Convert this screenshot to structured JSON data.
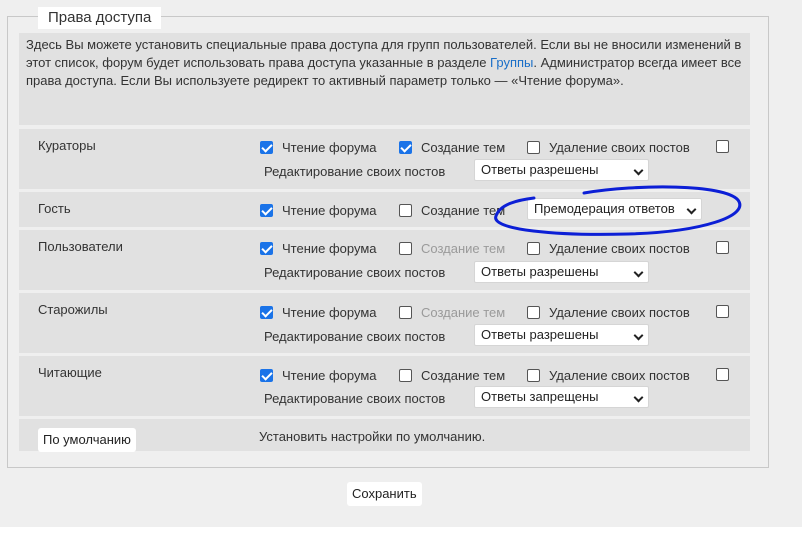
{
  "title": "Права доступа",
  "notice": {
    "text_before_link": "Здесь Вы можете установить специальные права доступа для групп пользователей. Если вы не вносили изменений в этот список, форум будет использовать права доступа указанные в разделе ",
    "link": "Группы",
    "text_after_link": ". Администратор всегда имеет все права доступа. Если Вы используете редирект то активный параметр только — «Чтение форума»."
  },
  "labels": {
    "read": "Чтение форума",
    "create": "Создание тем",
    "delete": "Удаление своих постов",
    "edit": "Редактирование своих постов"
  },
  "groups": [
    {
      "name": "Кураторы",
      "read": true,
      "create": true,
      "create_disabled": false,
      "delete": false,
      "extra": false,
      "edit_value": "Ответы разрешены"
    },
    {
      "name": "Гость",
      "read": true,
      "create": false,
      "create_disabled": false,
      "guest_select": "Премодерация ответов"
    },
    {
      "name": "Пользователи",
      "read": true,
      "create": false,
      "create_disabled": true,
      "delete": false,
      "extra": false,
      "edit_value": "Ответы разрешены"
    },
    {
      "name": "Старожилы",
      "read": true,
      "create": false,
      "create_disabled": true,
      "delete": false,
      "extra": false,
      "edit_value": "Ответы разрешены"
    },
    {
      "name": "Читающие",
      "read": true,
      "create": false,
      "create_disabled": false,
      "delete": false,
      "extra": false,
      "edit_value": "Ответы запрещены"
    }
  ],
  "defaults": {
    "button": "По умолчанию",
    "text": "Установить настройки по умолчанию."
  },
  "save_button": "Сохранить",
  "colors": {
    "accent": "#1a73e8",
    "link": "#1a6fc8",
    "annotation": "#0c1fd6"
  }
}
